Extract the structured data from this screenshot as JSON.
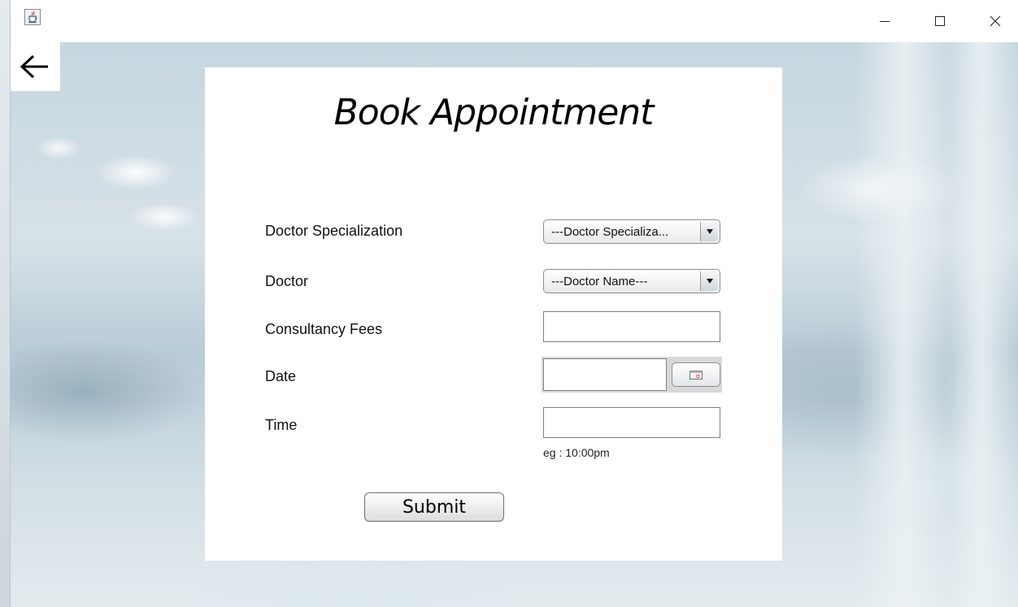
{
  "window": {
    "icon": "java-cup-icon",
    "controls": [
      "minimize-icon",
      "maximize-icon",
      "close-icon"
    ]
  },
  "nav": {
    "back_icon": "arrow-left-icon"
  },
  "form": {
    "title": "Book Appointment",
    "labels": {
      "specialization": "Doctor Specialization",
      "doctor": "Doctor",
      "fees": "Consultancy Fees",
      "date": "Date",
      "time": "Time"
    },
    "specialization_select": {
      "selected": "---Doctor Specializa..."
    },
    "doctor_select": {
      "selected": "---Doctor Name---"
    },
    "fees_value": "",
    "date_value": "",
    "time_value": "",
    "time_hint": "eg : 10:00pm",
    "submit_label": "Submit"
  },
  "colors": {
    "panel": "#ffffff",
    "background": "#c6d6df"
  }
}
